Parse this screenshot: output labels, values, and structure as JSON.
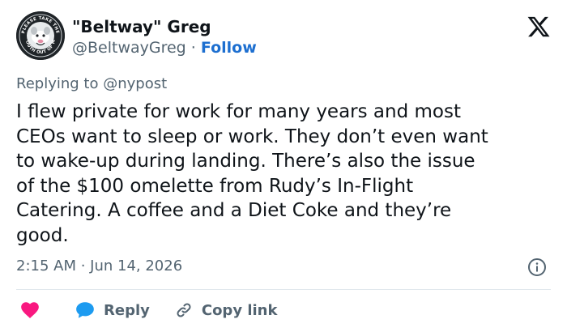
{
  "author": {
    "display_name": "\"Beltway\" Greg",
    "handle": "@BeltwayGreg",
    "separator": " · ",
    "follow_label": "Follow",
    "avatar_badge_text": "PLEASE TAKE THE MOUTH OUT OF MY"
  },
  "brand_icon": "x-logo-icon",
  "reply_context": {
    "prefix": "Replying to ",
    "mention": "@nypost"
  },
  "tweet": {
    "text": "I flew private for work for many years and most\nCEOs want to sleep or work.  They don’t even want\nto wake-up during landing.  There’s also the issue\nof the $100 omelette from Rudy’s In-Flight\nCatering.  A coffee and a Diet Coke and they’re\ngood.",
    "timestamp": "2:15 AM · Jun 14, 2026"
  },
  "actions": {
    "like_icon": "heart-icon",
    "reply_label": "Reply",
    "reply_icon": "speech-bubble-icon",
    "copy_link_label": "Copy link",
    "copy_link_icon": "link-icon"
  },
  "colors": {
    "follow": "#1d6fd0",
    "heart": "#f91880",
    "reply": "#1d9bf0",
    "muted_text": "#536471",
    "main_text": "#0f1419"
  }
}
